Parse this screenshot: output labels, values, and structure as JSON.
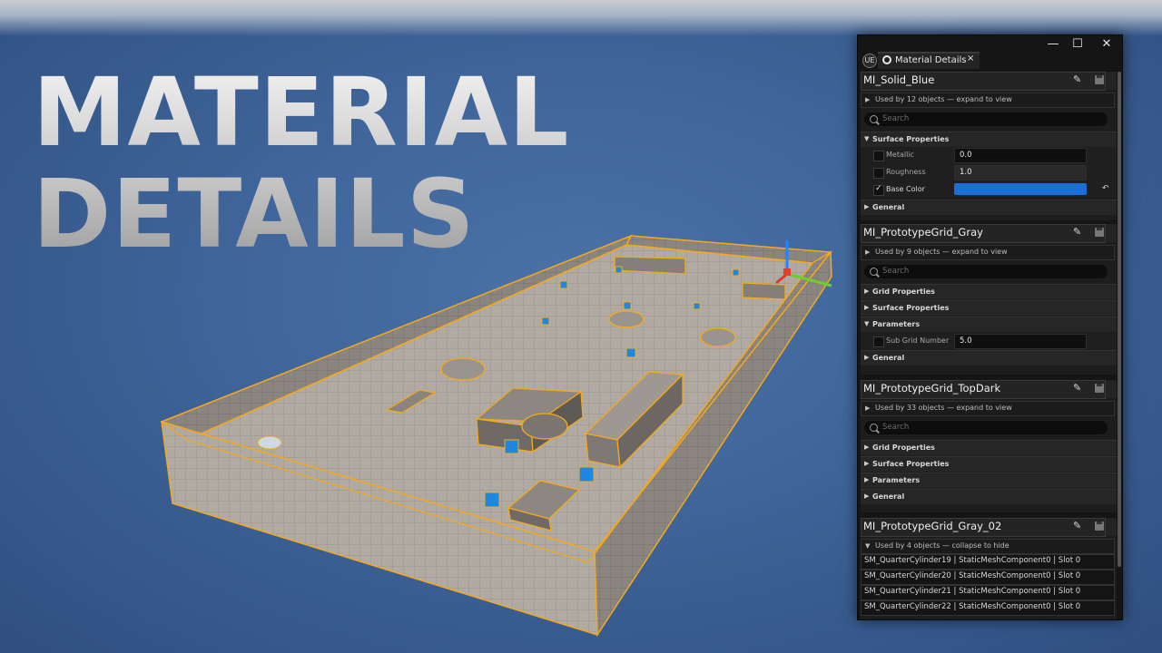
{
  "hero": {
    "line1": "MATERIAL",
    "line2": "DETAILS"
  },
  "window": {
    "controls": {
      "minimize": "—",
      "maximize": "☐",
      "close": "✕"
    },
    "tab": {
      "label": "Material Details",
      "close": "×",
      "logo": "UE"
    },
    "icons": {
      "edit": "pencil-icon",
      "save": "save-icon",
      "search": "search-icon",
      "reset": "reset-arrow-icon"
    },
    "panels": [
      {
        "title": "MI_Solid_Blue",
        "used_by": "Used by 12 objects — expand to view",
        "search_placeholder": "Search",
        "categories": [
          "Surface Properties",
          "General"
        ],
        "props": [
          {
            "label": "Metallic",
            "value": "0.0",
            "checked": false
          },
          {
            "label": "Roughness",
            "value": "1.0",
            "checked": false
          },
          {
            "label": "Base Color",
            "color": "#1a6fd6",
            "checked": true
          }
        ]
      },
      {
        "title": "MI_PrototypeGrid_Gray",
        "used_by": "Used by 9 objects — expand to view",
        "search_placeholder": "Search",
        "categories": [
          "Grid Properties",
          "Surface Properties",
          "Parameters",
          "General"
        ],
        "props": [
          {
            "label": "Sub Grid Number",
            "value": "5.0",
            "checked": false
          }
        ]
      },
      {
        "title": "MI_PrototypeGrid_TopDark",
        "used_by": "Used by 33 objects — expand to view",
        "search_placeholder": "Search",
        "categories": [
          "Grid Properties",
          "Surface Properties",
          "Parameters",
          "General"
        ]
      },
      {
        "title": "MI_PrototypeGrid_Gray_02",
        "used_by": "Used by 4 objects — collapse to hide",
        "rows": [
          "SM_QuarterCylinder19 | StaticMeshComponent0 | Slot 0",
          "SM_QuarterCylinder20 | StaticMeshComponent0 | Slot 0",
          "SM_QuarterCylinder21 | StaticMeshComponent0 | Slot 0",
          "SM_QuarterCylinder22 | StaticMeshComponent0 | Slot 0"
        ]
      }
    ]
  },
  "colors": {
    "background": "#3f6499",
    "selection": "#f4a91c",
    "accent_blue": "#1a6fd6"
  }
}
